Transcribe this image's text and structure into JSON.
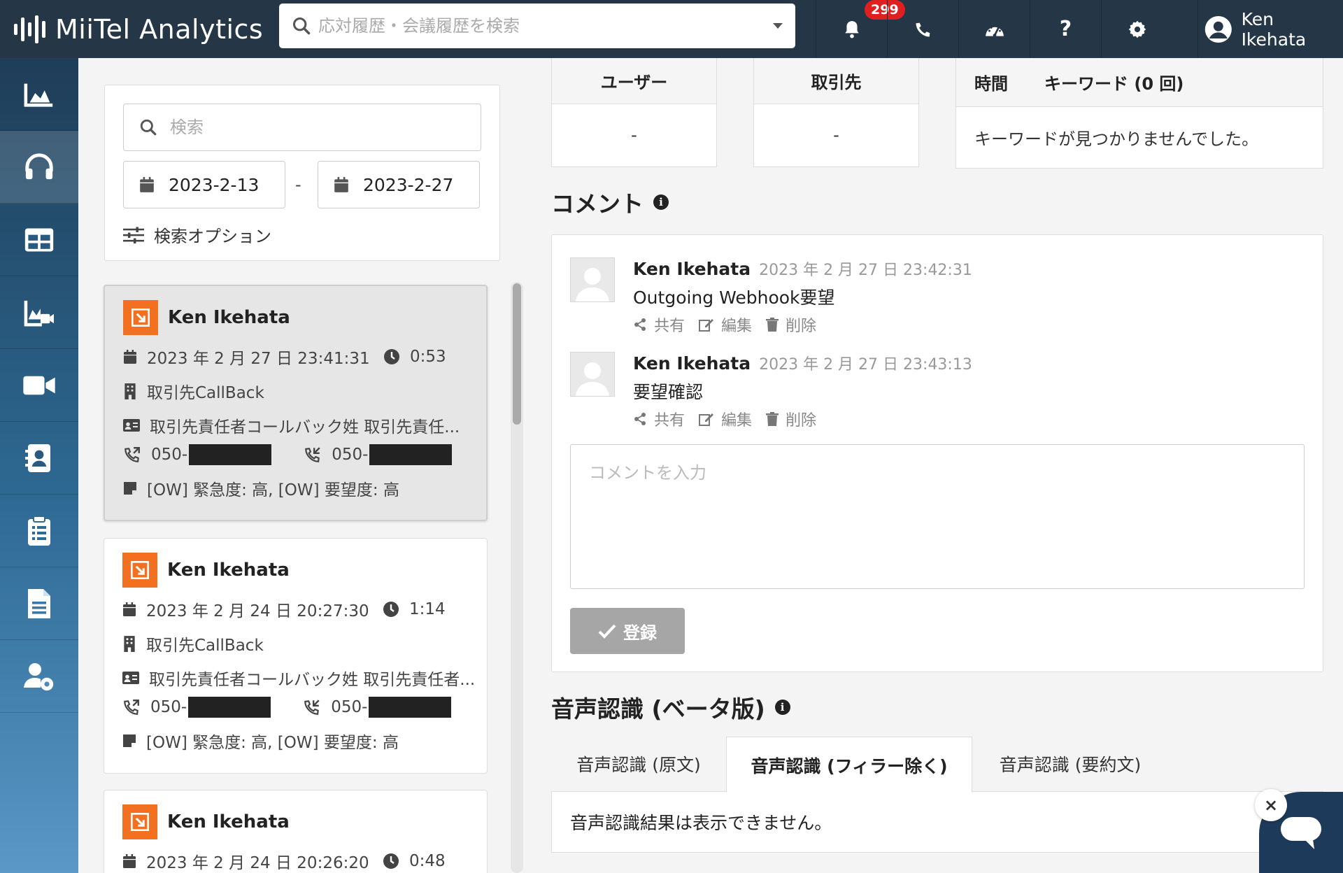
{
  "app": {
    "title": "MiiTel Analytics"
  },
  "header": {
    "search_placeholder": "応対履歴・会議履歴を検索",
    "notification_count": "299",
    "user_name": "Ken Ikehata",
    "icons": [
      "bell-icon",
      "phone-icon",
      "dashboard-icon",
      "help-icon",
      "gear-icon",
      "user-circle-icon"
    ]
  },
  "sidebar": {
    "items": [
      {
        "name": "analytics",
        "icon": "area-chart-icon",
        "active": false
      },
      {
        "name": "calls",
        "icon": "headset-icon",
        "active": true
      },
      {
        "name": "tables",
        "icon": "table-icon",
        "active": false
      },
      {
        "name": "reports",
        "icon": "chart-video-icon",
        "active": false
      },
      {
        "name": "meetings",
        "icon": "video-camera-icon",
        "active": false
      },
      {
        "name": "contacts",
        "icon": "address-book-icon",
        "active": false
      },
      {
        "name": "tasks",
        "icon": "clipboard-icon",
        "active": false
      },
      {
        "name": "documents",
        "icon": "document-icon",
        "active": false
      },
      {
        "name": "user-settings",
        "icon": "user-gear-icon",
        "active": false
      }
    ]
  },
  "filters": {
    "search_placeholder": "検索",
    "date_from": "2023-2-13",
    "date_separator": "-",
    "date_to": "2023-2-27",
    "options_label": "検索オプション"
  },
  "calls": [
    {
      "name": "Ken Ikehata",
      "datetime": "2023 年 2 月 27 日 23:41:31",
      "duration": "0:53",
      "company": "取引先CallBack",
      "contact": "取引先責任者コールバック姓 取引先責任...",
      "phone_from": "050-",
      "phone_to": "050-",
      "tags": "[OW] 緊急度: 高, [OW] 要望度: 高",
      "selected": true
    },
    {
      "name": "Ken Ikehata",
      "datetime": "2023 年 2 月 24 日 20:27:30",
      "duration": "1:14",
      "company": "取引先CallBack",
      "contact": "取引先責任者コールバック姓 取引先責任者...",
      "phone_from": "050-",
      "phone_to": "050-",
      "tags": "[OW] 緊急度: 高, [OW] 要望度: 高",
      "selected": false
    },
    {
      "name": "Ken Ikehata",
      "datetime": "2023 年 2 月 24 日 20:26:20",
      "duration": "0:48",
      "selected": false
    }
  ],
  "details": {
    "user_header": "ユーザー",
    "user_value": "-",
    "client_header": "取引先",
    "client_value": "-",
    "time_header": "時間",
    "keyword_header": "キーワード (0 回)",
    "keyword_value": "キーワードが見つかりませんでした。"
  },
  "comments": {
    "title": "コメント",
    "items": [
      {
        "author": "Ken Ikehata",
        "time": "2023 年 2 月 27 日 23:42:31",
        "text": "Outgoing Webhook要望"
      },
      {
        "author": "Ken Ikehata",
        "time": "2023 年 2 月 27 日 23:43:13",
        "text": "要望確認"
      }
    ],
    "actions": {
      "share": "共有",
      "edit": "編集",
      "delete": "削除"
    },
    "input_placeholder": "コメントを入力",
    "submit_label": "登録"
  },
  "transcription": {
    "title": "音声認識 (ベータ版)",
    "tabs": [
      {
        "label": "音声認識 (原文)",
        "active": false
      },
      {
        "label": "音声認識 (フィラー除く)",
        "active": true
      },
      {
        "label": "音声認識 (要約文)",
        "active": false
      }
    ],
    "message": "音声認識結果は表示できません。"
  },
  "colors": {
    "header_bg": "#253746",
    "accent_orange": "#f37021",
    "badge_red": "#e02020",
    "submit_disabled": "#a6a6a6"
  }
}
